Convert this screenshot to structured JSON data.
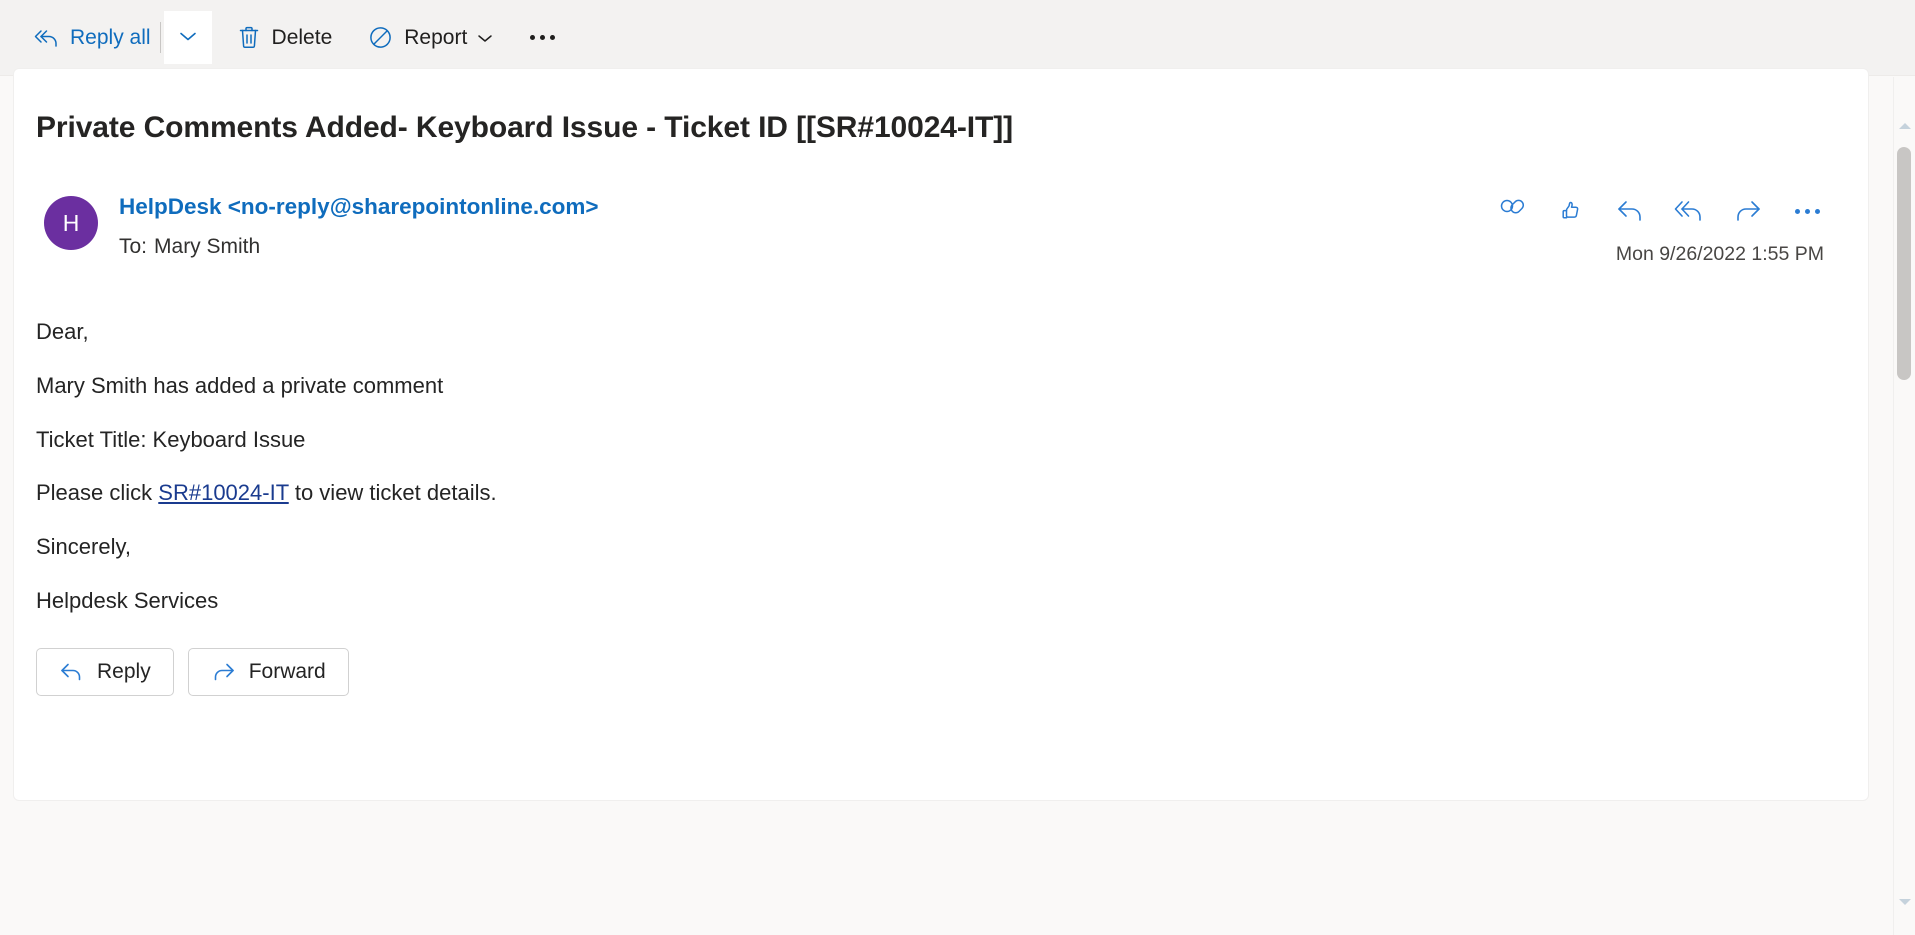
{
  "toolbar": {
    "reply_all": {
      "label": "Reply all",
      "icon": "reply-all-icon"
    },
    "reply_all_dropdown": {
      "icon": "chevron-down-icon"
    },
    "delete": {
      "label": "Delete",
      "icon": "trash-icon"
    },
    "report": {
      "label": "Report",
      "icon": "block-icon",
      "chevron": "chevron-down-icon"
    },
    "more": {
      "icon": "more-horizontal-icon"
    }
  },
  "message": {
    "subject": "Private Comments Added- Keyboard Issue - Ticket ID [[SR#10024-IT]]",
    "avatar_initial": "H",
    "avatar_color": "#6b2fa0",
    "sender": "HelpDesk <no-reply@sharepointonline.com>",
    "to_label": "To:",
    "to_value": "Mary Smith",
    "timestamp": "Mon 9/26/2022 1:55 PM",
    "header_actions": [
      {
        "name": "reactions-icon"
      },
      {
        "name": "thumbs-up-icon"
      },
      {
        "name": "reply-icon"
      },
      {
        "name": "reply-all-icon"
      },
      {
        "name": "forward-icon"
      },
      {
        "name": "more-horizontal-icon"
      }
    ],
    "body": {
      "greeting": "Dear,",
      "line_comment": "Mary Smith has added a private comment",
      "line_title": "Ticket Title: Keyboard Issue",
      "line_click_prefix": "Please click ",
      "link_text": "SR#10024-IT",
      "line_click_suffix": " to view ticket details.",
      "closing": "Sincerely,",
      "signature": "Helpdesk Services"
    }
  },
  "footer": {
    "reply": {
      "label": "Reply",
      "icon": "reply-icon"
    },
    "forward": {
      "label": "Forward",
      "icon": "forward-icon"
    }
  },
  "scrollbar": {
    "up_arrow": "scroll-up-arrow",
    "down_arrow": "scroll-down-arrow"
  },
  "colors": {
    "accent": "#0f6cbd",
    "link": "#1a3b8f",
    "avatar": "#6b2fa0",
    "toolbar_bg": "#f3f2f1",
    "page_bg": "#faf9f8"
  }
}
